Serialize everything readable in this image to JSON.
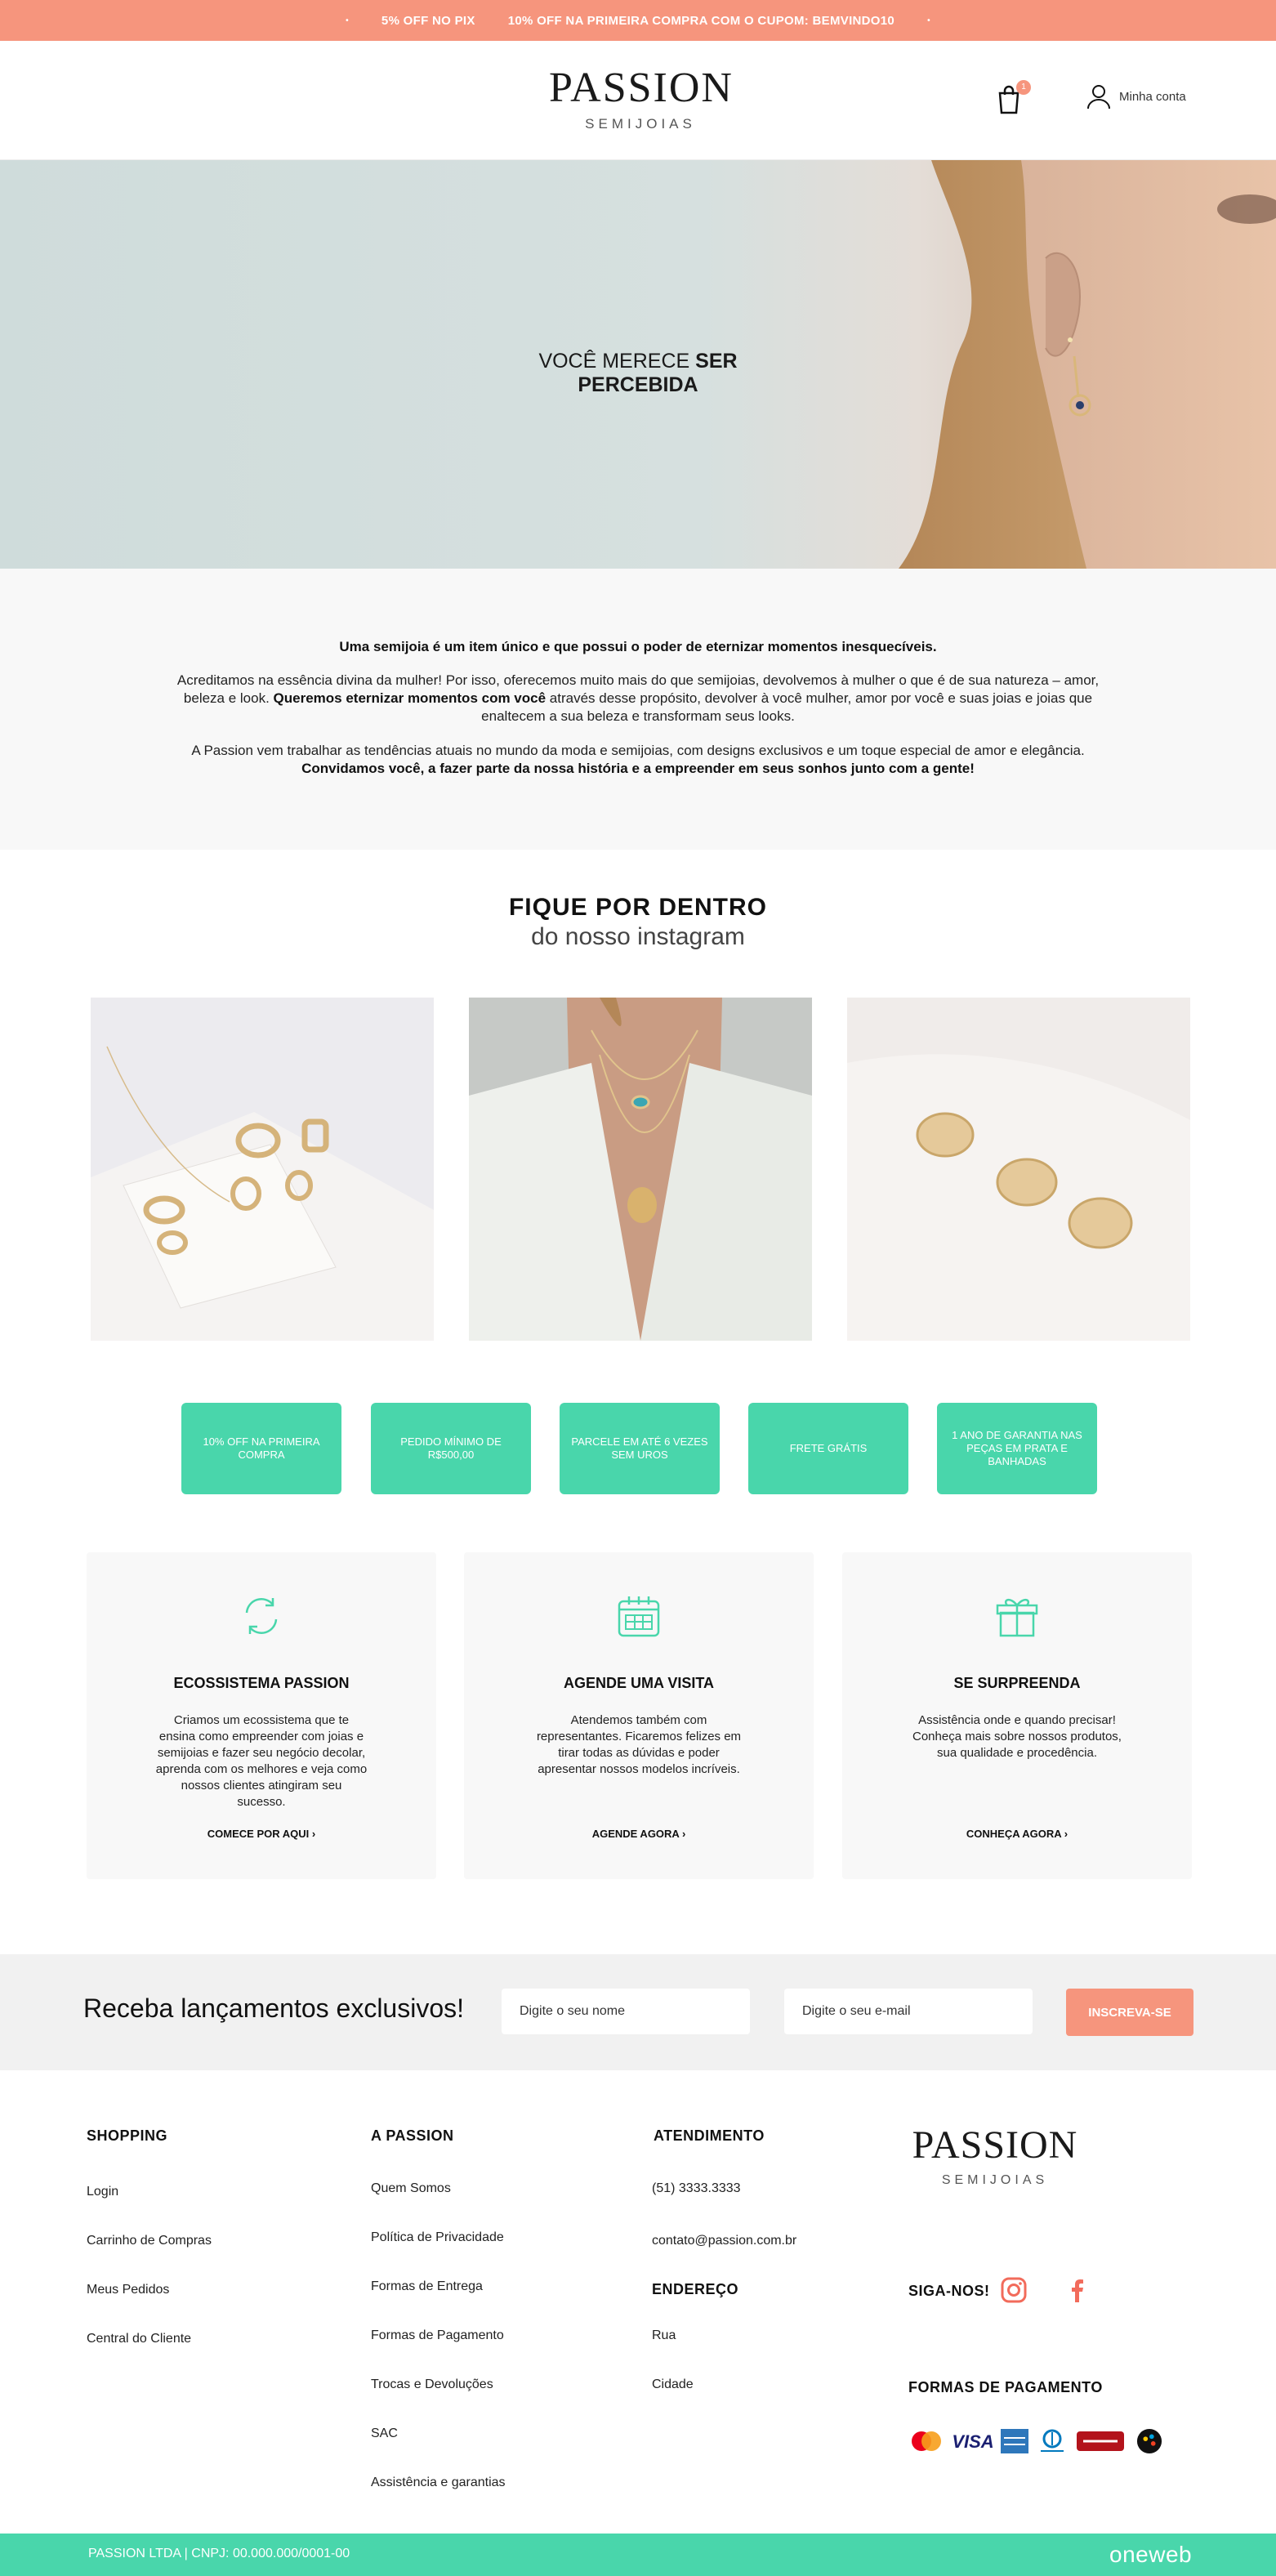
{
  "topbar": {
    "promo_pix": "5% OFF NO PIX",
    "promo_coupon": "10% OFF NA PRIMEIRA COMPRA COM O CUPOM: BEMVINDO10"
  },
  "header": {
    "logo_main": "PASSION",
    "logo_sub": "SEMIJOIAS",
    "cart_count": "1",
    "account_label": "Minha conta"
  },
  "hero": {
    "title_regular": "VOCÊ MERECE ",
    "title_bold": "SER PERCEBIDA"
  },
  "about": {
    "lead": "Uma semijoia é um item único e que possui o poder de eternizar momentos inesquecíveis.",
    "p1_a": "Acreditamos na essência divina da mulher! Por isso, oferecemos muito mais do que semijoias, devolvemos à mulher o que é de sua natureza – amor, beleza e look. ",
    "p1_b": "Queremos eternizar momentos com você",
    "p1_c": " através desse propósito, devolver à você mulher, amor por você e suas joias e joias que enaltecem a sua beleza e transformam seus looks.",
    "p2_a": "A Passion vem trabalhar as tendências atuais no mundo da moda e semijoias, com designs exclusivos e um toque especial de amor e elegância. ",
    "p2_b": "Convidamos você, a fazer parte da nossa história e a empreender em seus sonhos junto com a gente!"
  },
  "instagram": {
    "title": "FIQUE POR DENTRO",
    "subtitle": "do nosso instagram"
  },
  "perks": [
    {
      "label": "10% OFF NA PRIMEIRA COMPRA"
    },
    {
      "label": "PEDIDO MÍNIMO DE R$500,00"
    },
    {
      "label": "PARCELE EM ATÉ 6 VEZES SEM UROS"
    },
    {
      "label": "FRETE GRÁTIS"
    },
    {
      "label": "1 ANO DE GARANTIA NAS PEÇAS EM PRATA E BANHADAS"
    }
  ],
  "cards": [
    {
      "icon": "refresh-icon",
      "title": "ECOSSISTEMA PASSION",
      "text": "Criamos um ecossistema que te ensina como empreender com joias e semijoias e fazer seu negócio decolar, aprenda com os melhores e veja como nossos clientes atingiram seu sucesso.",
      "link": "COMECE POR AQUI ›"
    },
    {
      "icon": "calendar-icon",
      "title": "AGENDE UMA VISITA",
      "text": "Atendemos também com representantes. Ficaremos felizes em tirar todas as dúvidas e poder apresentar nossos modelos incríveis.",
      "link": "AGENDE AGORA ›"
    },
    {
      "icon": "gift-icon",
      "title": "SE SURPREENDA",
      "text": "Assistência onde e quando precisar! Conheça mais sobre nossos produtos, sua qualidade e procedência.",
      "link": "CONHEÇA AGORA ›"
    }
  ],
  "newsletter": {
    "heading": "Receba lançamentos exclusivos!",
    "name_placeholder": "Digite o seu nome",
    "email_placeholder": "Digite o seu e-mail",
    "button": "INSCREVA-SE"
  },
  "footer": {
    "shopping_title": "SHOPPING",
    "shopping_links": [
      "Login",
      "Carrinho de Compras",
      "Meus Pedidos",
      "Central do Cliente"
    ],
    "passion_title": "A PASSION",
    "passion_links": [
      "Quem Somos",
      "Política de Privacidade",
      "Formas de Entrega",
      "Formas de Pagamento",
      "Trocas e Devoluções",
      "SAC",
      "Assistência e garantias"
    ],
    "atendimento_title": "ATENDIMENTO",
    "phone": "(51) 3333.3333",
    "email": "contato@passion.com.br",
    "endereco_title": "ENDEREÇO",
    "street": "Rua",
    "city": "Cidade",
    "logo_main": "PASSION",
    "logo_sub": "SEMIJOIAS",
    "follow_title": "SIGA-NOS!",
    "payment_title": "FORMAS DE PAGAMENTO",
    "payment_methods": [
      "MasterCard",
      "VISA",
      "AMEX",
      "Diners Club",
      "Hipercard",
      "elo"
    ]
  },
  "bottombar": {
    "legal": "PASSION LTDA | CNPJ: 00.000.000/0001-00",
    "brand": "oneweb"
  },
  "colors": {
    "coral": "#f6957d",
    "mint": "#49d6ab"
  }
}
